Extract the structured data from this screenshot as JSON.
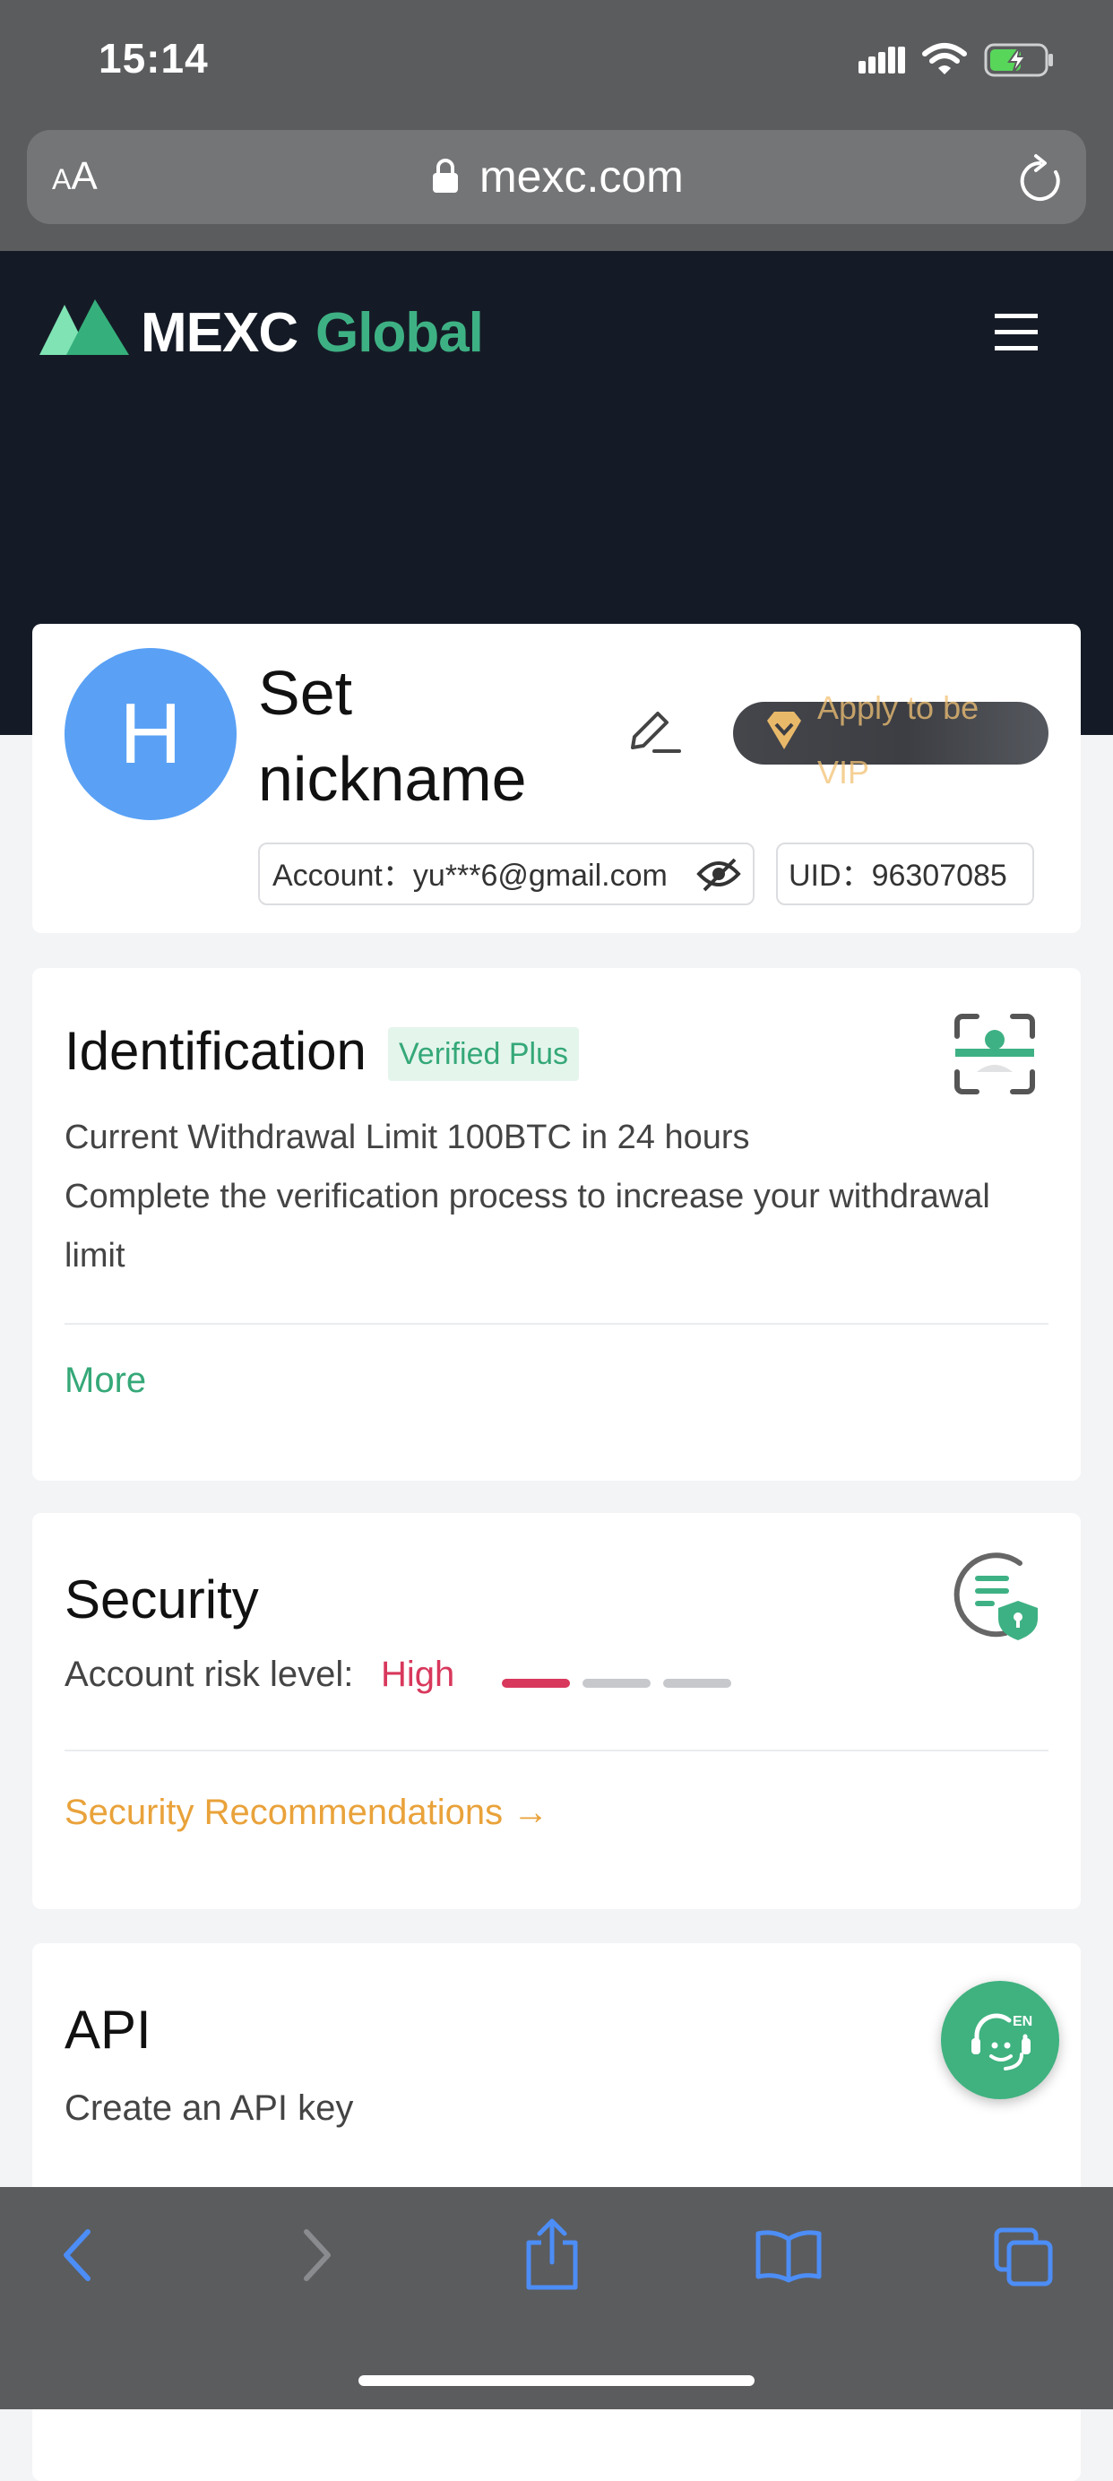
{
  "status_bar": {
    "time": "15:14"
  },
  "browser": {
    "text_size_label_small": "A",
    "text_size_label_large": "A",
    "url": "mexc.com"
  },
  "header": {
    "logo_word": "MEXC",
    "logo_suffix": "Global"
  },
  "profile": {
    "avatar_letter": "H",
    "nickname": "Set nickname",
    "vip_button": "Apply to be VIP",
    "account_label": "Account：",
    "account_value": "yu***6@gmail.com",
    "uid_label": "UID：",
    "uid_value": "96307085"
  },
  "identification": {
    "title": "Identification",
    "badge": "Verified Plus",
    "limit_text": "Current Withdrawal Limit 100BTC in 24 hours",
    "hint_text": "Complete the verification process to increase your withdrawal limit",
    "more_link": "More"
  },
  "security": {
    "title": "Security",
    "risk_label": "Account risk level:",
    "risk_value": "High",
    "risk_level": 1,
    "risk_levels_total": 3,
    "recommendations_link": "Security Recommendations →",
    "colors": {
      "high": "#d8385c",
      "inactive": "#c6c8cc"
    }
  },
  "api": {
    "title": "API",
    "description": "Create an API key"
  },
  "support": {
    "chat_badge": "EN"
  },
  "colors": {
    "brand_green": "#3eb184",
    "warning_orange": "#e9a23a",
    "avatar_blue": "#5aa1f5"
  }
}
